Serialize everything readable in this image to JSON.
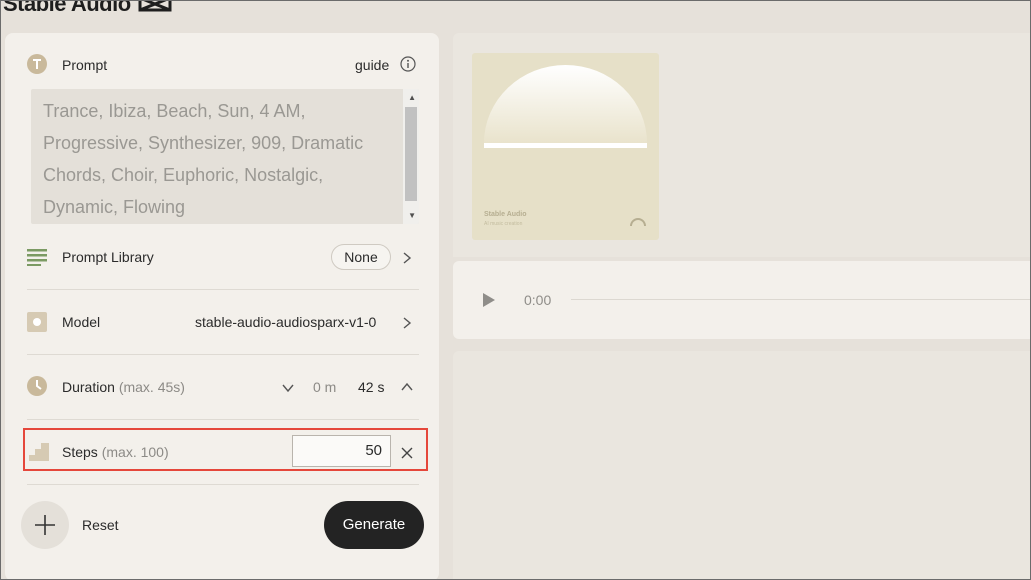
{
  "app": {
    "brand": "Stable Audio"
  },
  "prompt": {
    "label": "Prompt",
    "guide_label": "guide",
    "value": "Trance, Ibiza, Beach, Sun, 4 AM, Progressive, Synthesizer, 909, Dramatic Chords, Choir, Euphoric, Nostalgic, Dynamic, Flowing"
  },
  "prompt_library": {
    "label": "Prompt Library",
    "value": "None"
  },
  "model": {
    "label": "Model",
    "value": "stable-audio-audiosparx-v1-0"
  },
  "duration": {
    "label": "Duration",
    "max": "(max. 45s)",
    "minutes": "0 m",
    "seconds": "42 s"
  },
  "steps": {
    "label": "Steps",
    "max": "(max. 100)",
    "value": "50"
  },
  "actions": {
    "reset_label": "Reset",
    "generate_label": "Generate"
  },
  "cover": {
    "brand": "Stable Audio",
    "sub": "AI music creation"
  },
  "player": {
    "time": "0:00"
  },
  "colors": {
    "accent": "#c9b99b",
    "danger": "#e5473b",
    "dark_button": "#232323",
    "library_icon": "#7b9a63"
  }
}
